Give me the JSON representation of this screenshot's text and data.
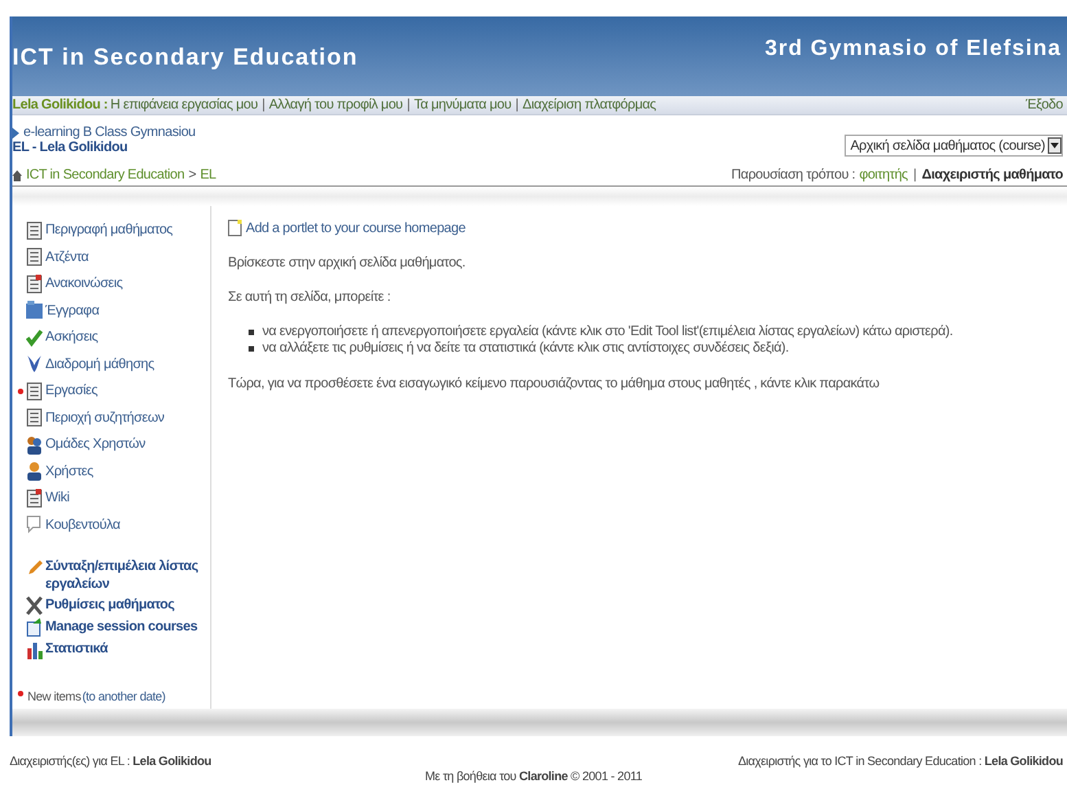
{
  "header": {
    "title": "ICT in Secondary Education",
    "institution": "3rd Gymnasio of Elefsina"
  },
  "user_bar": {
    "user": "Lela Golikidou :",
    "separator": "|",
    "links": [
      "Η επιφάνεια εργασίας μου",
      "Αλλαγή του προφίλ μου",
      "Τα μηνύματα μου",
      "Διαχείριση πλατφόρμας"
    ],
    "logout": "Έξοδο"
  },
  "course": {
    "name": "e-learning B Class Gymnasiou",
    "code_teacher": "EL - Lela Golikidou",
    "selector": "Αρχική σελίδα μαθήματος (course)"
  },
  "breadcrumb": {
    "items": [
      "ICT in Secondary Education",
      "EL"
    ],
    "separator": ">"
  },
  "view_mode": {
    "label": "Παρουσίαση τρόπου :",
    "separator": "|",
    "options": [
      {
        "label": "φοιτητής",
        "selected": false
      },
      {
        "label": "Διαχειριστής μαθήματο",
        "selected": true
      }
    ]
  },
  "tools": [
    {
      "label": "Περιγραφή μαθήματος",
      "new": false
    },
    {
      "label": "Ατζέντα",
      "new": false
    },
    {
      "label": "Ανακοινώσεις",
      "new": false
    },
    {
      "label": "Έγγραφα",
      "new": false
    },
    {
      "label": "Ασκήσεις",
      "new": false
    },
    {
      "label": "Διαδρομή μάθησης",
      "new": false
    },
    {
      "label": "Εργασίες",
      "new": true
    },
    {
      "label": "Περιοχή συζητήσεων",
      "new": false
    },
    {
      "label": "Ομάδες Χρηστών",
      "new": false
    },
    {
      "label": "Χρήστες",
      "new": false
    },
    {
      "label": "Wiki",
      "new": false
    },
    {
      "label": "Κουβεντούλα",
      "new": false
    }
  ],
  "admin_tools": [
    "Σύνταξη/επιμέλεια λίστας εργαλείων",
    "Ρυθμίσεις μαθήματος",
    "Manage session courses",
    "Στατιστικά"
  ],
  "legend": {
    "text": "New items",
    "note": "(to another date)"
  },
  "main": {
    "portlet_link": "Add a portlet to your course homepage",
    "intro": "Βρίσκεστε στην αρχική σελίδα μαθήματος.",
    "lead": "Σε αυτή τη σελίδα, μπορείτε :",
    "bullets": [
      "να ενεργοποιήσετε ή απενεργοποιήσετε εργαλεία (κάντε κλικ στο 'Edit Tool list'(επιμέλεια λίστας εργαλείων) κάτω αριστερά).",
      "να αλλάξετε τις ρυθμίσεις ή να δείτε τα στατιστικά (κάντε κλικ στις αντίστοιχες συνδέσεις δεξιά)."
    ],
    "outro": "Τώρα, για να προσθέσετε ένα εισαγωγικό κείμενο παρουσιάζοντας το μάθημα στους μαθητές , κάντε κλικ παρακάτω"
  },
  "footer": {
    "left": "Διαχειριστής(ες) για EL : **Lela Golikidou**",
    "right": "Διαχειριστής για το ICT in Secondary Education : **Lela Golikidou**",
    "credit": "Με τη βοήθεια του **Claroline** © 2001 - 2011"
  }
}
